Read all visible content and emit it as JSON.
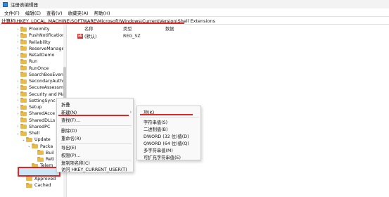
{
  "window": {
    "title": "注册表编辑器"
  },
  "menubar": [
    "文件(F)",
    "编辑(E)",
    "查看(V)",
    "收藏夹(A)",
    "帮助(H)"
  ],
  "address": "计算机\\HKEY_LOCAL_MACHINE\\SOFTWARE\\Microsoft\\Windows\\CurrentVersion\\Shell Extensions",
  "tree": [
    {
      "label": "Proximity",
      "indent": 0,
      "chev": ">"
    },
    {
      "label": "PushNotifications",
      "indent": 0,
      "chev": ">"
    },
    {
      "label": "Reliability",
      "indent": 0,
      "chev": ">"
    },
    {
      "label": "ReserveManager",
      "indent": 0,
      "chev": ">"
    },
    {
      "label": "RetailDemo",
      "indent": 0,
      "chev": ">"
    },
    {
      "label": "Run",
      "indent": 0,
      "chev": ""
    },
    {
      "label": "RunOnce",
      "indent": 0,
      "chev": ""
    },
    {
      "label": "SearchBoxEventArg",
      "indent": 0,
      "chev": ""
    },
    {
      "label": "SecondaryAuthFacto",
      "indent": 0,
      "chev": ">"
    },
    {
      "label": "SecureAssessment",
      "indent": 0,
      "chev": ">"
    },
    {
      "label": "Security and Mainte",
      "indent": 0,
      "chev": ">"
    },
    {
      "label": "SettingSync",
      "indent": 0,
      "chev": ">"
    },
    {
      "label": "Setup",
      "indent": 0,
      "chev": ">"
    },
    {
      "label": "SharedAcce",
      "indent": 0,
      "chev": ">"
    },
    {
      "label": "SharedDLLs",
      "indent": 0,
      "chev": ""
    },
    {
      "label": "SharedPC",
      "indent": 0,
      "chev": ">"
    },
    {
      "label": "Shell",
      "indent": 0,
      "chev": "v"
    },
    {
      "label": "Update",
      "indent": 1,
      "chev": "v"
    },
    {
      "label": "Packa",
      "indent": 2,
      "chev": "v"
    },
    {
      "label": "Buil",
      "indent": 3,
      "chev": ""
    },
    {
      "label": "Reti",
      "indent": 3,
      "chev": ""
    },
    {
      "label": "Telem",
      "indent": 2,
      "chev": ""
    },
    {
      "label": "Shell Extens",
      "indent": 0,
      "chev": "v",
      "selected": true
    },
    {
      "label": "Approved",
      "indent": 1,
      "chev": ""
    },
    {
      "label": "Cached",
      "indent": 1,
      "chev": ""
    }
  ],
  "list": {
    "headers": {
      "name": "名称",
      "type": "类型",
      "data": "数据"
    },
    "rows": [
      {
        "icon": "ab",
        "name": "(默认)",
        "type": "REG_SZ"
      }
    ]
  },
  "context_menu": {
    "items": [
      "折叠",
      "新建(N)",
      "查找(F)...",
      "删除(D)",
      "重命名(R)",
      "导出(E)",
      "权限(P)...",
      "复制项名称(C)",
      "访问 HKEY_CURRENT_USER(T)"
    ]
  },
  "submenu": {
    "items": [
      "项(K)",
      "字符串值(S)",
      "二进制值(B)",
      "DWORD (32 位)值(D)",
      "QWORD (64 位)值(Q)",
      "多字符串值(M)",
      "可扩充字符串值(E)"
    ]
  },
  "colors": {
    "highlight": "#e02525",
    "folder": "#e9b94a",
    "selection": "#cde6f7"
  }
}
